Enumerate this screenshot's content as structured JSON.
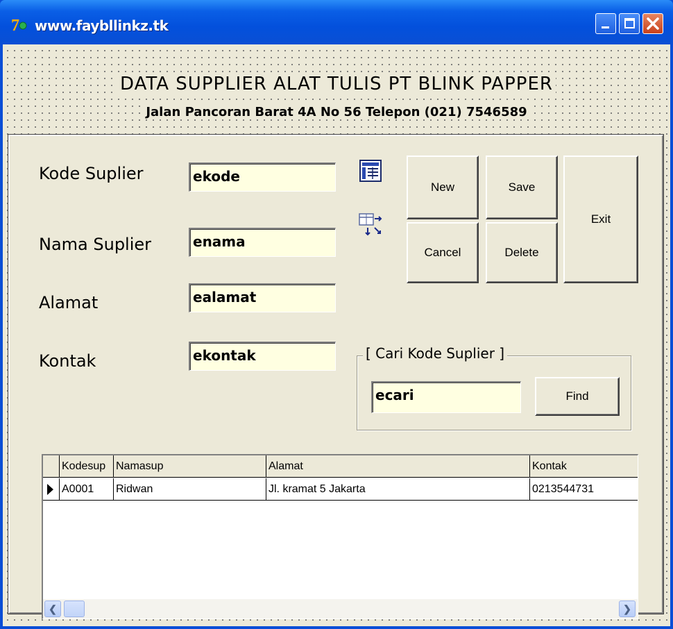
{
  "window": {
    "title": "www.faybllinkz.tk",
    "colors": {
      "titlebar": "#0a5fe6",
      "client": "#ece9d8",
      "edit_bg": "#ffffe1",
      "close_btn": "#c9401a"
    }
  },
  "header": {
    "title": "DATA SUPPLIER ALAT TULIS PT BLINK PAPPER",
    "subtitle": "Jalan Pancoran Barat 4A No 56  Telepon (021) 7546589"
  },
  "form": {
    "kode_label": "Kode Suplier",
    "kode_value": "ekode",
    "nama_label": "Nama Suplier",
    "nama_value": "enama",
    "alamat_label": "Alamat",
    "alamat_value": "ealamat",
    "kontak_label": "Kontak",
    "kontak_value": "ekontak"
  },
  "buttons": {
    "new": "New",
    "save": "Save",
    "exit": "Exit",
    "cancel": "Cancel",
    "delete": "Delete",
    "find": "Find"
  },
  "search": {
    "group_title": "[ Cari Kode Suplier ]",
    "value": "ecari"
  },
  "icons": {
    "top": "table-view-icon",
    "bottom": "table-transfer-icon"
  },
  "grid": {
    "columns": [
      "Kodesup",
      "Namasup",
      "Alamat",
      "Kontak"
    ],
    "rows": [
      [
        "A0001",
        "Ridwan",
        "Jl. kramat 5 Jakarta",
        "0213544731"
      ]
    ]
  }
}
